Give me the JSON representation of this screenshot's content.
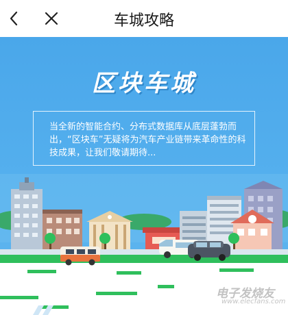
{
  "header": {
    "title": "车城攻略",
    "back_icon": "chevron-left-icon",
    "close_icon": "close-icon"
  },
  "banner": {
    "headline": "区块车城",
    "intro": "当全新的智能合约、分布式数据库从底层蓬勃而出，“区块车”无疑将为汽车产业链带来革命性的科技成果，让我们敬请期待..."
  },
  "watermark": {
    "text": "电子发烧友",
    "sub": "www.elecfans.com"
  },
  "colors": {
    "sky": "#4aa7ea",
    "grass": "#2fbf5c",
    "road": "#ffffff"
  }
}
